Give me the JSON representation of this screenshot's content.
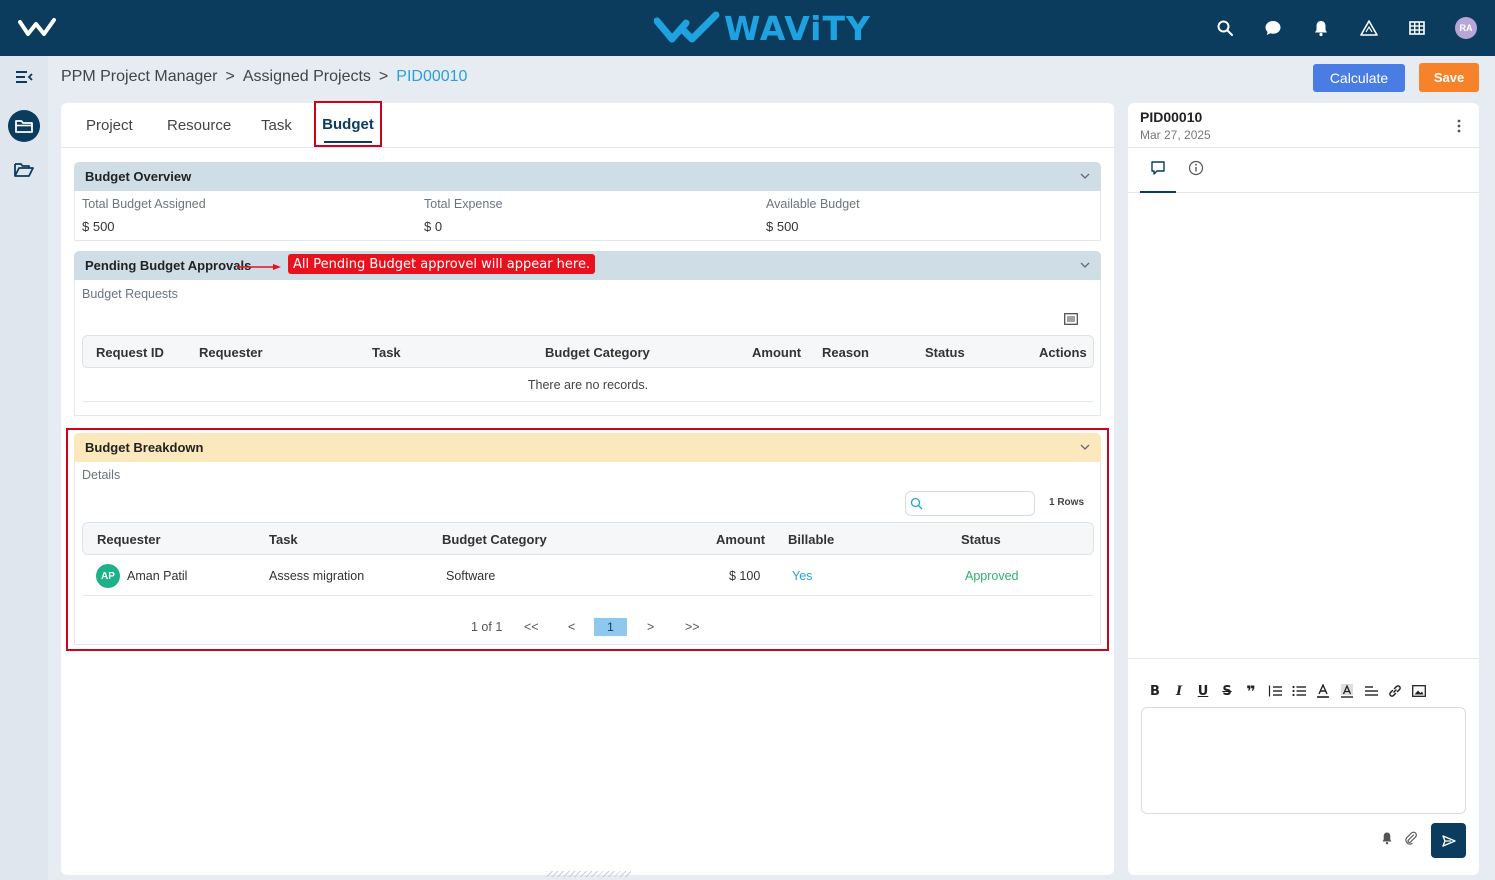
{
  "app": {
    "brand": "WAViTY"
  },
  "header": {
    "user_initials": "RA"
  },
  "breadcrumb": [
    "PPM Project Manager",
    "Assigned Projects",
    "PID00010"
  ],
  "breadcrumb_sep": ">",
  "actions": {
    "calculate": "Calculate",
    "save": "Save"
  },
  "tabs": [
    "Project",
    "Resource",
    "Task",
    "Budget"
  ],
  "active_tab": "Budget",
  "overview": {
    "title": "Budget Overview",
    "items": [
      {
        "label": "Total Budget Assigned",
        "value": "$ 500"
      },
      {
        "label": "Total Expense",
        "value": "$ 0"
      },
      {
        "label": "Available Budget",
        "value": "$ 500"
      }
    ]
  },
  "pending": {
    "title": "Pending Budget Approvals",
    "annotation": "All Pending Budget approvel will appear here.",
    "subtitle": "Budget Requests",
    "columns": [
      "Request ID",
      "Requester",
      "Task",
      "Budget Category",
      "Amount",
      "Reason",
      "Status",
      "Actions"
    ],
    "empty": "There are no records."
  },
  "breakdown": {
    "title": "Budget Breakdown",
    "subtitle": "Details",
    "search_placeholder": "",
    "rows_count": "1 Rows",
    "columns": [
      "Requester",
      "Task",
      "Budget Category",
      "Amount",
      "Billable",
      "Status"
    ],
    "rows": [
      {
        "initials": "AP",
        "requester": "Aman Patil",
        "task": "Assess migration",
        "category": "Software",
        "amount": "$ 100",
        "billable": "Yes",
        "status": "Approved"
      }
    ],
    "pager": {
      "label": "1 of 1",
      "first": "<<",
      "prev": "<",
      "page": "1",
      "next": ">",
      "last": ">>"
    }
  },
  "right_panel": {
    "id": "PID00010",
    "date": "Mar 27, 2025",
    "toolbar": [
      "B",
      "I",
      "U",
      "S",
      "❞"
    ]
  },
  "colors": {
    "topbar": "#0b3c5d",
    "accent_blue": "#2aa0d8",
    "calculate": "#4a7de3",
    "save": "#f6822a",
    "annotation": "#e8121f",
    "approved": "#2db36b"
  }
}
